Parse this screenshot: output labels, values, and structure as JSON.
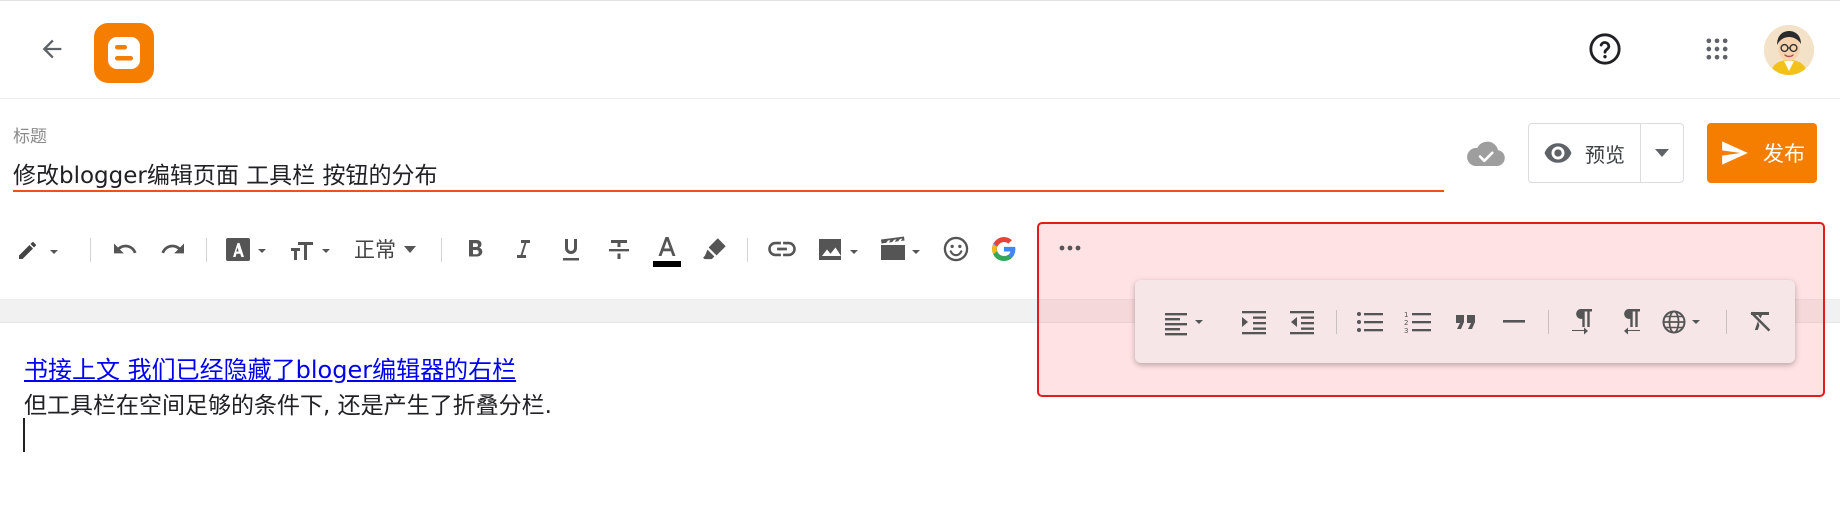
{
  "header": {
    "back_icon": "arrow-left-icon",
    "logo_icon": "blogger-logo",
    "help_icon": "help-circle-icon",
    "apps_icon": "apps-grid-icon",
    "avatar_icon": "user-avatar"
  },
  "title": {
    "label": "标题",
    "value": "修改blogger编辑页面 工具栏 按钮的分布"
  },
  "actions": {
    "sync_icon": "cloud-done-icon",
    "preview_label": "预览",
    "publish_label": "发布"
  },
  "toolbar": {
    "style_value": "正常",
    "items": [
      "pencil-dropdown",
      "undo",
      "redo",
      "font-family",
      "font-size",
      "paragraph-style",
      "bold",
      "italic",
      "underline",
      "strikethrough",
      "text-color",
      "highlight",
      "link",
      "image",
      "video",
      "emoji",
      "google-search",
      "more-options"
    ]
  },
  "overflow_menu": {
    "items": [
      "align",
      "indent",
      "outdent",
      "bulleted-list",
      "numbered-list",
      "quote",
      "horizontal-rule",
      "ltr",
      "rtl",
      "language",
      "clear-formatting"
    ]
  },
  "colors": {
    "accent": "#f57d00",
    "title_underline": "#e8531f",
    "highlight_border": "#e21b1b",
    "link": "#0000ee"
  },
  "content": {
    "link_line": "书接上文 我们已经隐藏了bloger编辑器的右栏",
    "line2": "但工具栏在空间足够的条件下, 还是产生了折叠分栏."
  }
}
